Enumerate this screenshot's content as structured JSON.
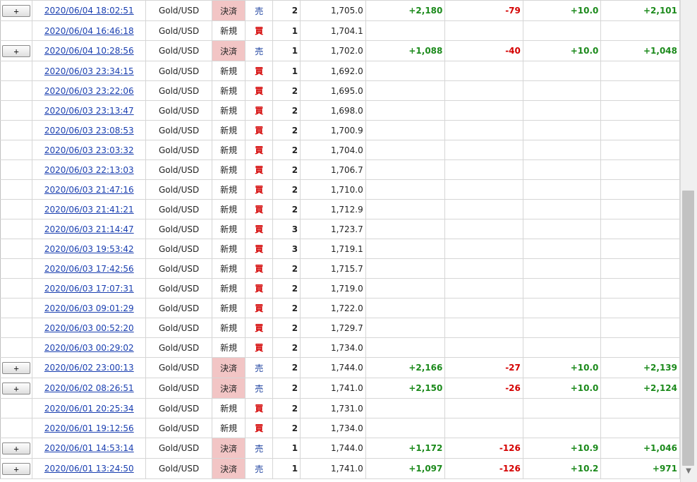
{
  "expand_label": "+",
  "rows": [
    {
      "expand": true,
      "time": "2020/06/04 18:02:51",
      "symbol": "Gold/USD",
      "type": "決済",
      "side": "売",
      "qty": "2",
      "price": "1,705.0",
      "pl": "+2,180",
      "swap": "-79",
      "comm": "+10.0",
      "total": "+2,101"
    },
    {
      "expand": false,
      "time": "2020/06/04 16:46:18",
      "symbol": "Gold/USD",
      "type": "新規",
      "side": "買",
      "qty": "1",
      "price": "1,704.1",
      "pl": "",
      "swap": "",
      "comm": "",
      "total": ""
    },
    {
      "expand": true,
      "time": "2020/06/04 10:28:56",
      "symbol": "Gold/USD",
      "type": "決済",
      "side": "売",
      "qty": "1",
      "price": "1,702.0",
      "pl": "+1,088",
      "swap": "-40",
      "comm": "+10.0",
      "total": "+1,048"
    },
    {
      "expand": false,
      "time": "2020/06/03 23:34:15",
      "symbol": "Gold/USD",
      "type": "新規",
      "side": "買",
      "qty": "1",
      "price": "1,692.0",
      "pl": "",
      "swap": "",
      "comm": "",
      "total": ""
    },
    {
      "expand": false,
      "time": "2020/06/03 23:22:06",
      "symbol": "Gold/USD",
      "type": "新規",
      "side": "買",
      "qty": "2",
      "price": "1,695.0",
      "pl": "",
      "swap": "",
      "comm": "",
      "total": ""
    },
    {
      "expand": false,
      "time": "2020/06/03 23:13:47",
      "symbol": "Gold/USD",
      "type": "新規",
      "side": "買",
      "qty": "2",
      "price": "1,698.0",
      "pl": "",
      "swap": "",
      "comm": "",
      "total": ""
    },
    {
      "expand": false,
      "time": "2020/06/03 23:08:53",
      "symbol": "Gold/USD",
      "type": "新規",
      "side": "買",
      "qty": "2",
      "price": "1,700.9",
      "pl": "",
      "swap": "",
      "comm": "",
      "total": ""
    },
    {
      "expand": false,
      "time": "2020/06/03 23:03:32",
      "symbol": "Gold/USD",
      "type": "新規",
      "side": "買",
      "qty": "2",
      "price": "1,704.0",
      "pl": "",
      "swap": "",
      "comm": "",
      "total": ""
    },
    {
      "expand": false,
      "time": "2020/06/03 22:13:03",
      "symbol": "Gold/USD",
      "type": "新規",
      "side": "買",
      "qty": "2",
      "price": "1,706.7",
      "pl": "",
      "swap": "",
      "comm": "",
      "total": ""
    },
    {
      "expand": false,
      "time": "2020/06/03 21:47:16",
      "symbol": "Gold/USD",
      "type": "新規",
      "side": "買",
      "qty": "2",
      "price": "1,710.0",
      "pl": "",
      "swap": "",
      "comm": "",
      "total": ""
    },
    {
      "expand": false,
      "time": "2020/06/03 21:41:21",
      "symbol": "Gold/USD",
      "type": "新規",
      "side": "買",
      "qty": "2",
      "price": "1,712.9",
      "pl": "",
      "swap": "",
      "comm": "",
      "total": ""
    },
    {
      "expand": false,
      "time": "2020/06/03 21:14:47",
      "symbol": "Gold/USD",
      "type": "新規",
      "side": "買",
      "qty": "3",
      "price": "1,723.7",
      "pl": "",
      "swap": "",
      "comm": "",
      "total": ""
    },
    {
      "expand": false,
      "time": "2020/06/03 19:53:42",
      "symbol": "Gold/USD",
      "type": "新規",
      "side": "買",
      "qty": "3",
      "price": "1,719.1",
      "pl": "",
      "swap": "",
      "comm": "",
      "total": ""
    },
    {
      "expand": false,
      "time": "2020/06/03 17:42:56",
      "symbol": "Gold/USD",
      "type": "新規",
      "side": "買",
      "qty": "2",
      "price": "1,715.7",
      "pl": "",
      "swap": "",
      "comm": "",
      "total": ""
    },
    {
      "expand": false,
      "time": "2020/06/03 17:07:31",
      "symbol": "Gold/USD",
      "type": "新規",
      "side": "買",
      "qty": "2",
      "price": "1,719.0",
      "pl": "",
      "swap": "",
      "comm": "",
      "total": ""
    },
    {
      "expand": false,
      "time": "2020/06/03 09:01:29",
      "symbol": "Gold/USD",
      "type": "新規",
      "side": "買",
      "qty": "2",
      "price": "1,722.0",
      "pl": "",
      "swap": "",
      "comm": "",
      "total": ""
    },
    {
      "expand": false,
      "time": "2020/06/03 00:52:20",
      "symbol": "Gold/USD",
      "type": "新規",
      "side": "買",
      "qty": "2",
      "price": "1,729.7",
      "pl": "",
      "swap": "",
      "comm": "",
      "total": ""
    },
    {
      "expand": false,
      "time": "2020/06/03 00:29:02",
      "symbol": "Gold/USD",
      "type": "新規",
      "side": "買",
      "qty": "2",
      "price": "1,734.0",
      "pl": "",
      "swap": "",
      "comm": "",
      "total": ""
    },
    {
      "expand": true,
      "time": "2020/06/02 23:00:13",
      "symbol": "Gold/USD",
      "type": "決済",
      "side": "売",
      "qty": "2",
      "price": "1,744.0",
      "pl": "+2,166",
      "swap": "-27",
      "comm": "+10.0",
      "total": "+2,139"
    },
    {
      "expand": true,
      "time": "2020/06/02 08:26:51",
      "symbol": "Gold/USD",
      "type": "決済",
      "side": "売",
      "qty": "2",
      "price": "1,741.0",
      "pl": "+2,150",
      "swap": "-26",
      "comm": "+10.0",
      "total": "+2,124"
    },
    {
      "expand": false,
      "time": "2020/06/01 20:25:34",
      "symbol": "Gold/USD",
      "type": "新規",
      "side": "買",
      "qty": "2",
      "price": "1,731.0",
      "pl": "",
      "swap": "",
      "comm": "",
      "total": ""
    },
    {
      "expand": false,
      "time": "2020/06/01 19:12:56",
      "symbol": "Gold/USD",
      "type": "新規",
      "side": "買",
      "qty": "2",
      "price": "1,734.0",
      "pl": "",
      "swap": "",
      "comm": "",
      "total": ""
    },
    {
      "expand": true,
      "time": "2020/06/01 14:53:14",
      "symbol": "Gold/USD",
      "type": "決済",
      "side": "売",
      "qty": "1",
      "price": "1,744.0",
      "pl": "+1,172",
      "swap": "-126",
      "comm": "+10.9",
      "total": "+1,046"
    },
    {
      "expand": true,
      "time": "2020/06/01 13:24:50",
      "symbol": "Gold/USD",
      "type": "決済",
      "side": "売",
      "qty": "1",
      "price": "1,741.0",
      "pl": "+1,097",
      "swap": "-126",
      "comm": "+10.2",
      "total": "+971"
    }
  ],
  "scroll": {
    "down_arrow_icon": "triangle-down-icon",
    "position_fraction": 0.4,
    "visible_fraction": 0.57
  },
  "colors": {
    "link": "#1a3fb0",
    "settle_bg": "#f2c5c5",
    "positive": "#1c8a1c",
    "negative": "#d40000",
    "sell": "#1a3f9e",
    "buy": "#d40000"
  }
}
